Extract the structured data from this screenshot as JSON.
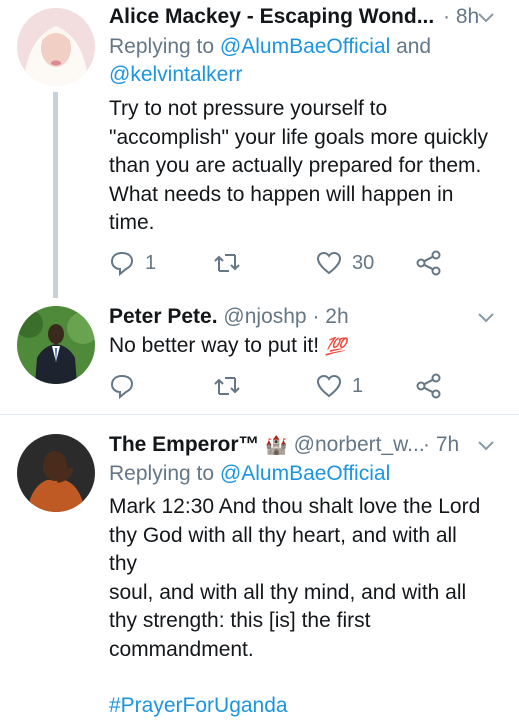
{
  "tweets": [
    {
      "name": "Alice Mackey - Escaping Wond...",
      "time": "· 8h",
      "reply_prefix": "Replying to",
      "reply_user1": "@AlumBaeOfficial",
      "reply_and": "and",
      "reply_user2": "@kelvintalkerr",
      "body": [
        "Try to not pressure yourself to",
        "\"accomplish\" your life goals more quickly",
        "than you are actually prepared for them.",
        "What needs to happen will happen in",
        "time."
      ],
      "reply_count": "1",
      "retweet_count": "",
      "like_count": "30"
    },
    {
      "name": "Peter Pete.",
      "handle": "@njoshp · 2h",
      "body": "No better way to put it!",
      "emoji": "💯",
      "reply_count": "",
      "retweet_count": "",
      "like_count": "1"
    },
    {
      "name": "The Emperor™",
      "emoji": "🏰",
      "handle": "@norbert_w...",
      "time": "· 7h",
      "reply_prefix": "Replying to",
      "reply_user1": "@AlumBaeOfficial",
      "body": [
        "Mark 12:30 And thou shalt love the Lord",
        "thy God with all thy heart, and with all thy",
        "soul, and with all thy mind, and with all",
        "thy strength: this [is] the first",
        "commandment."
      ],
      "hashtag": "#PrayerForUganda"
    }
  ],
  "colors": {
    "link": "#1b95e0",
    "muted": "#657786",
    "text": "#14171a"
  }
}
